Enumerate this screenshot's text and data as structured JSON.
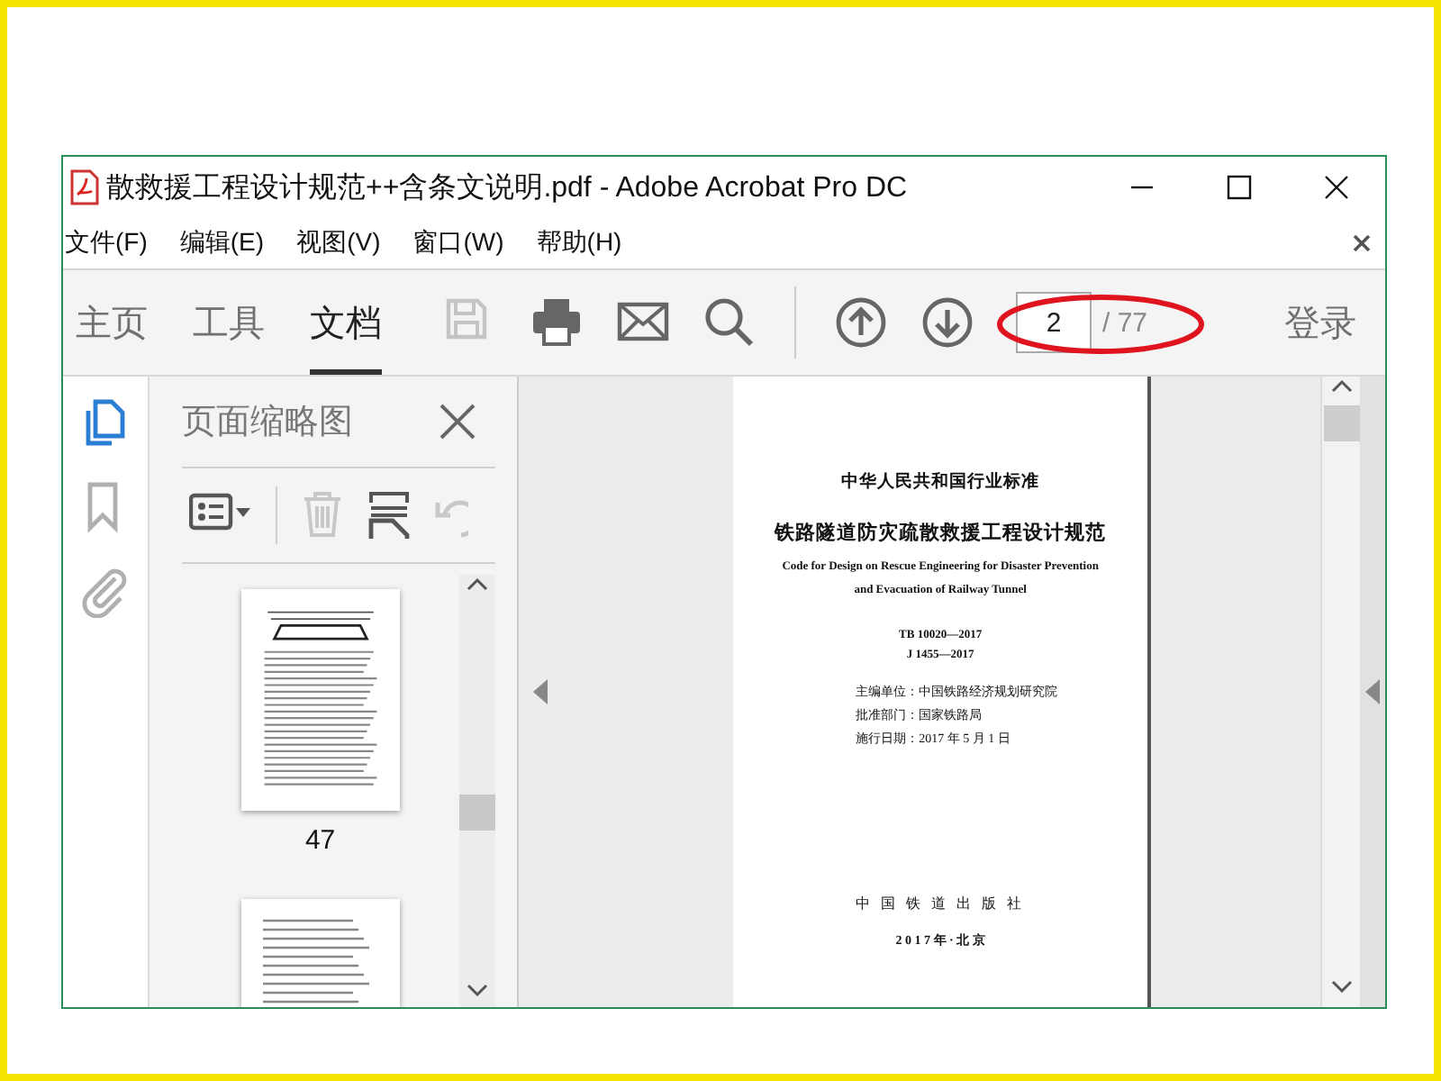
{
  "window": {
    "title": "散救援工程设计规范++含条文说明.pdf - Adobe Acrobat Pro DC"
  },
  "menu": [
    "文件(F)",
    "编辑(E)",
    "视图(V)",
    "窗口(W)",
    "帮助(H)"
  ],
  "tabs": [
    {
      "label": "主页",
      "selected": false
    },
    {
      "label": "工具",
      "selected": false
    },
    {
      "label": "文档",
      "selected": true
    }
  ],
  "toolbar": [
    {
      "kind": "save",
      "disabled": true
    },
    {
      "kind": "print",
      "disabled": false
    },
    {
      "kind": "mail",
      "disabled": false
    },
    {
      "kind": "search",
      "disabled": false
    },
    {
      "kind": "up",
      "disabled": false
    },
    {
      "kind": "down",
      "disabled": false
    }
  ],
  "page_field": {
    "value": "2",
    "total": "/ 77"
  },
  "login": "登录",
  "rail": [
    {
      "kind": "pages",
      "selected": true
    },
    {
      "kind": "bookmark",
      "selected": false
    },
    {
      "kind": "attach",
      "selected": false
    }
  ],
  "panel": {
    "title": "页面缩略图",
    "tools": [
      {
        "kind": "options",
        "disabled": false
      },
      {
        "kind": "trash",
        "disabled": true
      },
      {
        "kind": "extract",
        "disabled": false
      },
      {
        "kind": "rotate",
        "disabled": true
      }
    ],
    "thumbnails": [
      {
        "label": "47"
      }
    ]
  },
  "document": {
    "lines": [
      {
        "kind": "heading",
        "text": "中华人民共和国行业标准"
      },
      {
        "kind": "title",
        "text": "铁路隧道防灾疏散救援工程设计规范"
      },
      {
        "kind": "english",
        "text": "Code for Design on Rescue Engineering for Disaster Prevention"
      },
      {
        "kind": "english",
        "text": "and Evacuation of Railway Tunnel"
      },
      {
        "kind": "code",
        "text": "TB 10020—2017"
      },
      {
        "kind": "code",
        "text": "J 1455—2017"
      },
      {
        "kind": "info",
        "text": "主编单位：中国铁路经济规划研究院"
      },
      {
        "kind": "info",
        "text": "批准部门：国家铁路局"
      },
      {
        "kind": "info",
        "text": "施行日期：2017 年 5 月 1 日"
      },
      {
        "kind": "publisher",
        "text": "中 国 铁 道 出 版 社"
      },
      {
        "kind": "date",
        "text": "2 0 1 7 年 · 北 京"
      }
    ]
  }
}
